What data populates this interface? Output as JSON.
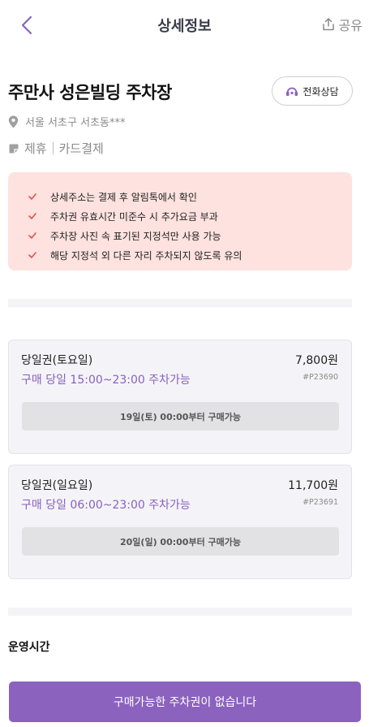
{
  "header": {
    "title": "상세정보",
    "share_label": "공유"
  },
  "lot": {
    "name": "주만사 성은빌딩 주차장",
    "call_label": "전화상담",
    "address": "서울 서초구 서초동***",
    "tags": [
      "제휴",
      "카드결제"
    ]
  },
  "notices": [
    "상세주소는 결제 후 알림톡에서 확인",
    "주차권 유효시간 미준수 시 추가요금 부과",
    "주차장 사진 속 표기된 지정석만 사용 가능",
    "해당 지정석 외 다른 자리 주차되지 않도록 유의"
  ],
  "tickets": [
    {
      "name": "당일권(토요일)",
      "price": "7,800원",
      "time": "구매 당일 15:00~23:00 주차가능",
      "code": "#P23690",
      "status": "19일(토) 00:00부터 구매가능"
    },
    {
      "name": "당일권(일요일)",
      "price": "11,700원",
      "time": "구매 당일 06:00~23:00 주차가능",
      "code": "#P23691",
      "status": "20일(일) 00:00부터 구매가능"
    }
  ],
  "operating_hours": {
    "title": "운영시간"
  },
  "cta": {
    "label": "구매가능한 주차권이 없습니다"
  },
  "colors": {
    "accent": "#8b62bd",
    "notice_bg": "#fde2df",
    "check": "#e0534a"
  }
}
